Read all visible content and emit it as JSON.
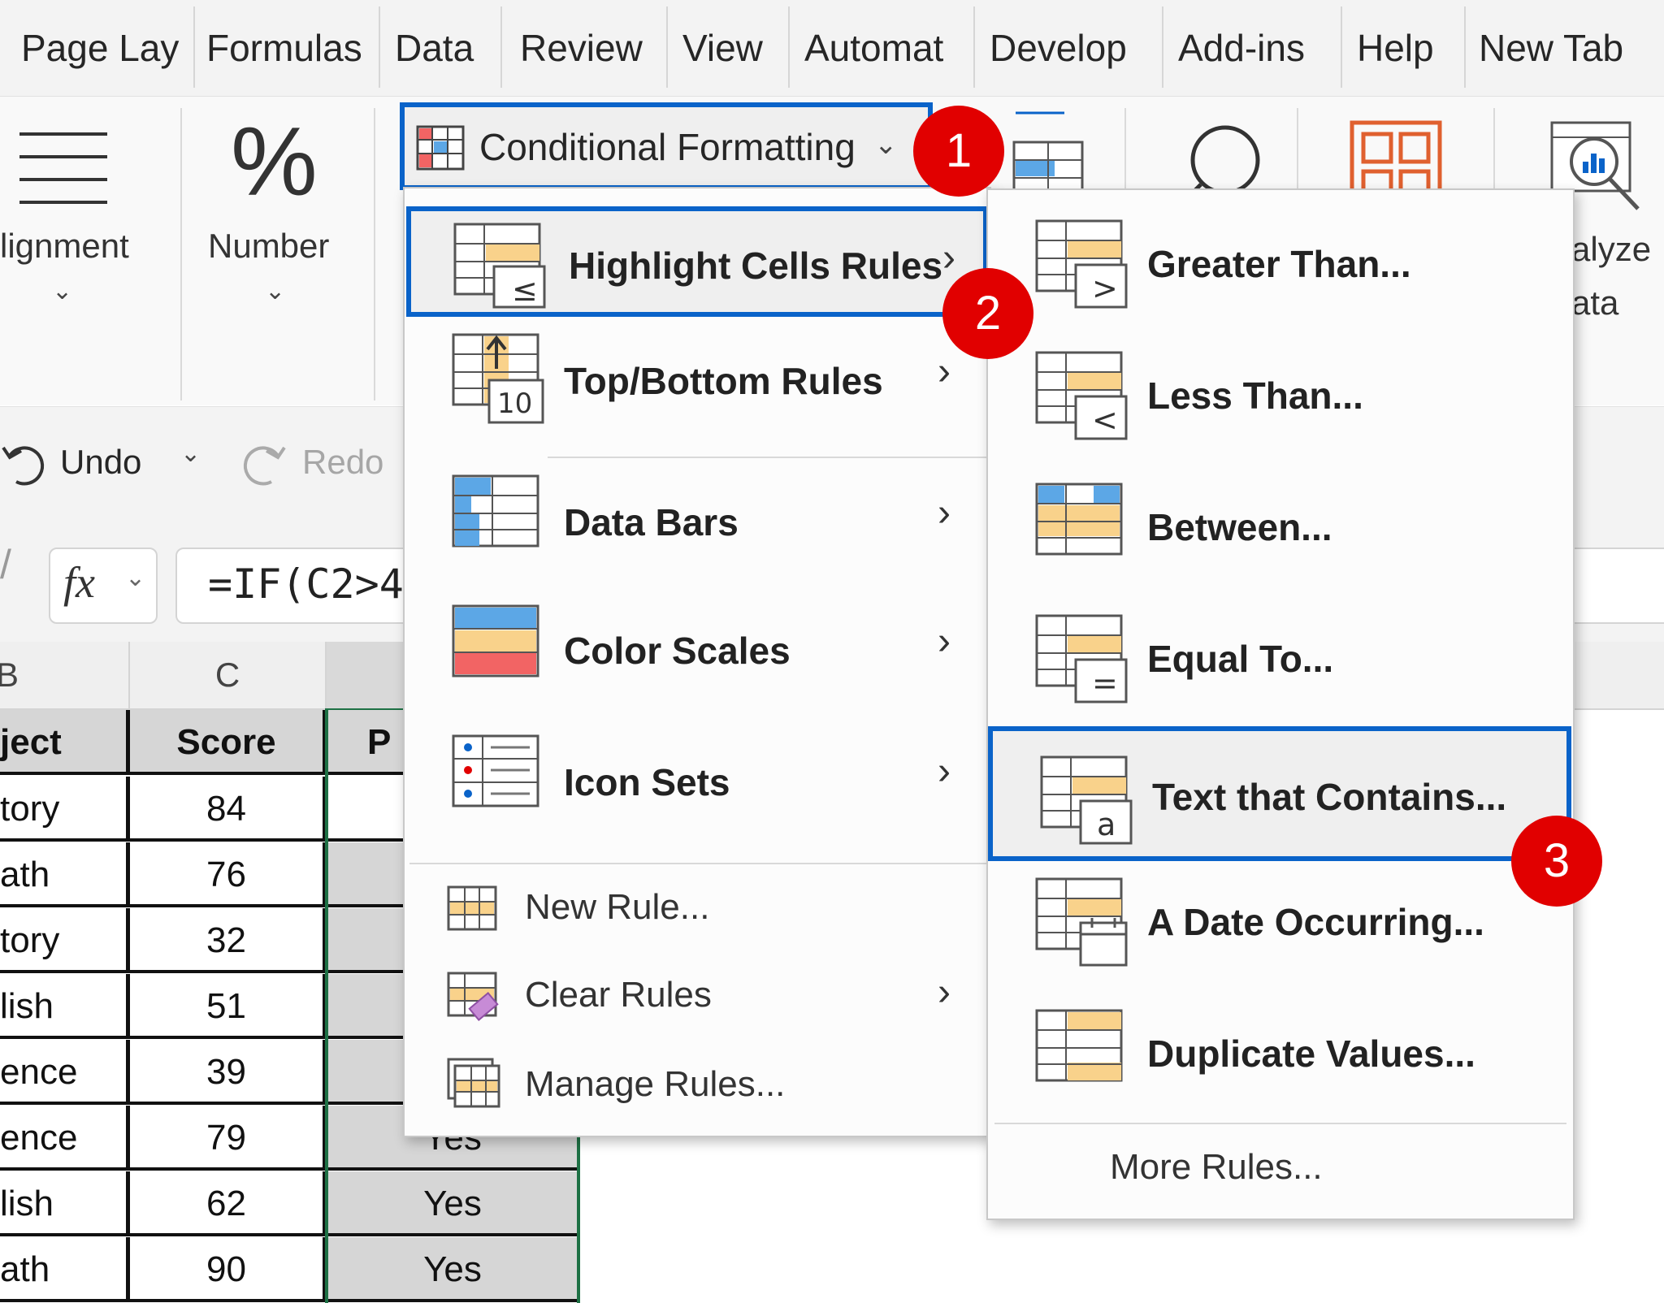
{
  "tabs": [
    "Page Lay",
    "Formulas",
    "Data",
    "Review",
    "View",
    "Automat",
    "Develop",
    "Add-ins",
    "Help",
    "New Tab"
  ],
  "ribbon": {
    "alignment_label": "lignment",
    "number_label": "Number",
    "percent_glyph": "%",
    "cf_button_label": "Conditional Formatting",
    "analyze_label_1": "alyze",
    "analyze_label_2": "ata"
  },
  "qat": {
    "undo_label": "Undo",
    "redo_label": "Redo"
  },
  "formula_bar": {
    "fx_label": "fx",
    "formula": "=IF(C2>4"
  },
  "sheet": {
    "col_b_header": "B",
    "col_c_header": "C",
    "header_row": [
      "ject",
      "Score",
      "P"
    ],
    "rows": [
      {
        "subject": "tory",
        "score": "84",
        "pass": ""
      },
      {
        "subject": "ath",
        "score": "76",
        "pass": ""
      },
      {
        "subject": "tory",
        "score": "32",
        "pass": ""
      },
      {
        "subject": "lish",
        "score": "51",
        "pass": ""
      },
      {
        "subject": "ence",
        "score": "39",
        "pass": ""
      },
      {
        "subject": "ence",
        "score": "79",
        "pass": "Yes"
      },
      {
        "subject": "lish",
        "score": "62",
        "pass": "Yes"
      },
      {
        "subject": "ath",
        "score": "90",
        "pass": "Yes"
      }
    ]
  },
  "cf_menu": {
    "items": [
      {
        "label": "Highlight Cells Rules"
      },
      {
        "label": "Top/Bottom Rules"
      },
      {
        "label": "Data Bars"
      },
      {
        "label": "Color Scales"
      },
      {
        "label": "Icon Sets"
      }
    ],
    "small_items": [
      {
        "label": "New Rule..."
      },
      {
        "label": "Clear Rules"
      },
      {
        "label": "Manage Rules..."
      }
    ]
  },
  "hcr_submenu": {
    "items": [
      {
        "label": "Greater Than..."
      },
      {
        "label": "Less Than..."
      },
      {
        "label": "Between..."
      },
      {
        "label": "Equal To..."
      },
      {
        "label": "Text that Contains..."
      },
      {
        "label": "A Date Occurring..."
      },
      {
        "label": "Duplicate Values..."
      }
    ],
    "more_rules": "More Rules..."
  },
  "badges": [
    "1",
    "2",
    "3"
  ],
  "icon_glyphs": {
    "top10": "10",
    "less_equal": "≤",
    "greater": ">",
    "less": "<",
    "equal": "=",
    "text_a": "a"
  },
  "colors": {
    "highlight_border": "#0a63c9",
    "badge_red": "#e10000",
    "fill_orange": "#f9d28b",
    "fill_blue": "#5ca7e6",
    "fill_red": "#f26464"
  }
}
